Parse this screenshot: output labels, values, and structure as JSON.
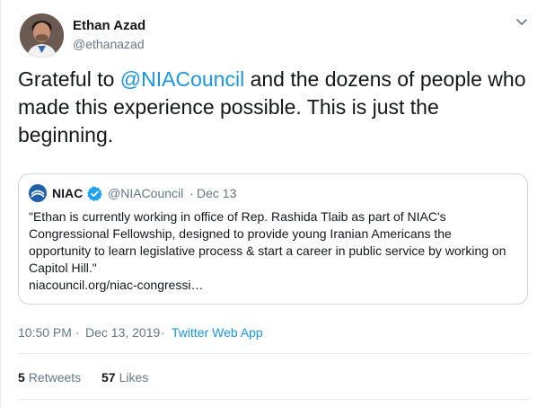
{
  "author": {
    "name": "Ethan Azad",
    "handle": "@ethanazad"
  },
  "tweet": {
    "text_before": "Grateful to ",
    "mention": "@NIACouncil",
    "text_after": " and the dozens of people who made this experience possible. This is just the beginning."
  },
  "quoted": {
    "name": "NIAC",
    "handle": "@NIACouncil",
    "separator": "·",
    "date": "Dec 13",
    "text": "\"Ethan is currently working in office of Rep. Rashida Tlaib as part of NIAC's Congressional Fellowship, designed to provide young Iranian Americans the opportunity to learn legislative process & start a career in public service by working on Capitol Hill.\"",
    "link": "niacouncil.org/niac-congressi…"
  },
  "meta": {
    "time": "10:50 PM",
    "separator": "·",
    "date": "Dec 13, 2019",
    "source": "Twitter Web App"
  },
  "stats": {
    "retweets_count": "5",
    "retweets_label": "Retweets",
    "likes_count": "57",
    "likes_label": "Likes"
  },
  "colors": {
    "link": "#1b95e0",
    "muted": "#657786",
    "text": "#14171a",
    "verified": "#1da1f2"
  },
  "icons": {
    "caret": "chevron-down-icon",
    "verified": "verified-badge-icon",
    "logo": "niac-logo-icon"
  }
}
